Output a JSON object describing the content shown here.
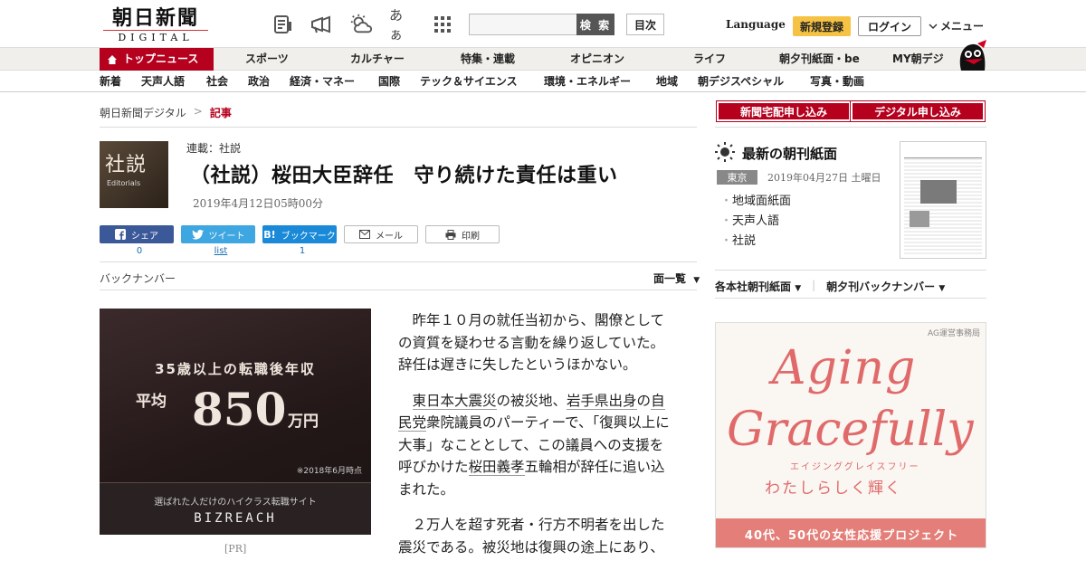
{
  "header": {
    "logo_jp": "朝日新聞",
    "logo_en": "DIGITAL",
    "icons": [
      "news-icon",
      "megaphone-icon",
      "weather-icon",
      "font-size-icon",
      "apps-grid-icon"
    ],
    "font_size_label": "あぁ",
    "search_placeholder": "",
    "search_button": "検 索",
    "toc_button": "目次",
    "language": "Language",
    "register": "新規登録",
    "login": "ログイン",
    "menu": "メニュー"
  },
  "nav_primary": [
    "トップニュース",
    "スポーツ",
    "カルチャー",
    "特集・連載",
    "オピニオン",
    "ライフ",
    "朝夕刊紙面・be",
    "MY朝デジ"
  ],
  "nav_secondary": [
    "新着",
    "天声人語",
    "社会",
    "政治",
    "経済・マネー",
    "国際",
    "テック＆サイエンス",
    "環境・エネルギー",
    "地域",
    "朝デジスペシャル",
    "写真・動画"
  ],
  "breadcrumb": {
    "home": "朝日新聞デジタル",
    "sep": ">",
    "current": "記事"
  },
  "article": {
    "thumb_kanji": "社説",
    "thumb_en": "Editorials",
    "series": "連載：社説",
    "title": "（社説）桜田大臣辞任　守り続けた責任は重い",
    "date": "2019年4月12日05時00分",
    "share": {
      "facebook": "シェア",
      "facebook_count": "0",
      "twitter": "ツイート",
      "twitter_count": "list",
      "hatena": "ブックマーク",
      "hatena_badge": "B!",
      "hatena_count": "1",
      "mail": "メール",
      "print": "印刷"
    },
    "back_number": "バックナンバー",
    "page_list": "面一覧",
    "paragraphs": {
      "p1": "昨年１０月の就任当初から、閣僚としての資質を疑わせる言動を繰り返していた。辞任は遅きに失したというほかない。",
      "p2a": "東日本大震災",
      "p2b": "の被災地、",
      "p2c": "岩手県出身",
      "p2d": "の",
      "p2e": "自民党",
      "p2f": "衆院議員のパーティーで、「復興以上に大事」なこととして、この議員への支援を呼びかけた",
      "p2g": "桜田義孝",
      "p2h": "五輪相が辞任に追い込まれた。",
      "p3": "２万人を超す死者・行方不明者を出した震災である。被災地は復興の途上にあり、"
    }
  },
  "ad_left": {
    "line1": "35歳以上の転職後年収",
    "avg": "平均",
    "amount": "850",
    "unit": "万円",
    "note": "※2018年6月時点",
    "sub": "選ばれた人だけのハイクラス転職サイト",
    "brand": "BIZREACH",
    "pr": "[PR]"
  },
  "sidebar": {
    "subscribe_paper": "新聞宅配申し込み",
    "subscribe_digital": "デジタル申し込み",
    "latest_title": "最新の朝刊紙面",
    "region": "東京",
    "paper_date": "2019年04月27日 土曜日",
    "links": [
      "地域面紙面",
      "天声人語",
      "社説"
    ],
    "edition_link": "各本社朝刊紙面",
    "evening_link": "朝夕刊バックナンバー"
  },
  "ad_right": {
    "agency": "AG運営事務局",
    "word1": "Aging",
    "word2": "Gracefully",
    "kana": "エイジンググレイスフリー",
    "tagline": "わたしらしく輝く",
    "band": "40代、50代の女性応援プロジェクト"
  },
  "colors": {
    "brand_red": "#b5001e",
    "register_yellow": "#f5c244",
    "ad_pink": "#e06a6a"
  }
}
